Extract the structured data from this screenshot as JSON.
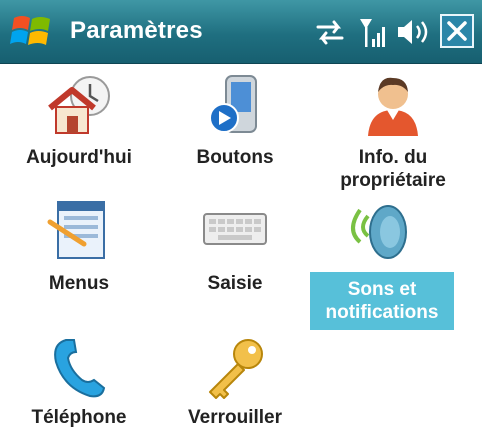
{
  "titlebar": {
    "title": "Paramètres",
    "icons": [
      "windows-logo-icon",
      "sync-icon",
      "signal-icon",
      "volume-icon",
      "close-icon"
    ],
    "close_label": "✕"
  },
  "colors": {
    "titlebar": "#1f6f80",
    "selection": "#57c0d9",
    "label": "#222222"
  },
  "items": [
    {
      "label": "Aujourd'hui",
      "icon": "home-clock-icon"
    },
    {
      "label": "Boutons",
      "icon": "device-buttons-icon"
    },
    {
      "label": "Info. du propriétaire",
      "icon": "owner-person-icon"
    },
    {
      "label": "Menus",
      "icon": "menus-window-icon"
    },
    {
      "label": "Saisie",
      "icon": "keyboard-icon"
    },
    {
      "label": "Sons et notifications",
      "icon": "speaker-sound-icon",
      "selected": true
    },
    {
      "label": "Téléphone",
      "icon": "phone-handset-icon"
    },
    {
      "label": "Verrouiller",
      "icon": "key-icon"
    }
  ]
}
